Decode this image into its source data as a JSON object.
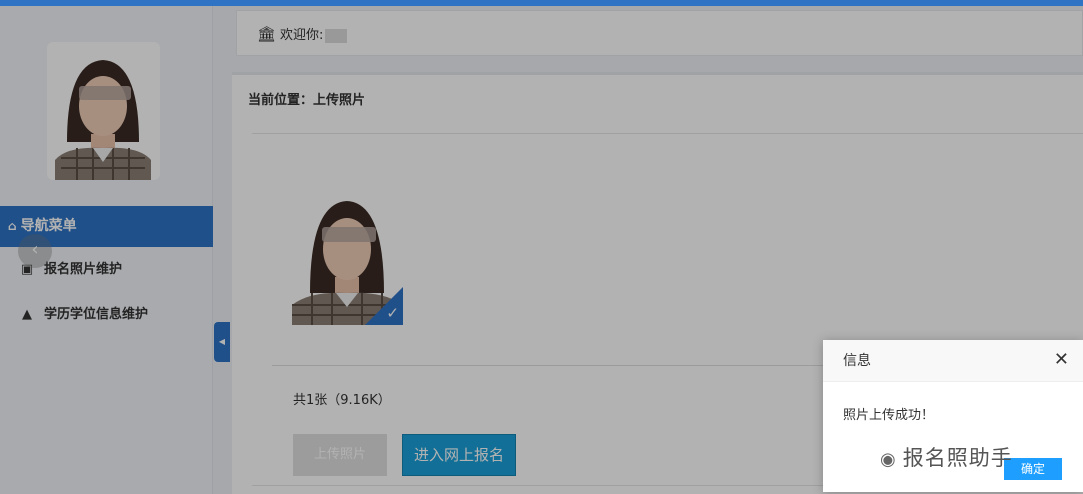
{
  "colors": {
    "accent": "#2f73c4",
    "primary_button": "#1aa0d8",
    "dialog_ok": "#1e9fff"
  },
  "header": {
    "welcome_label": "欢迎你:",
    "bank_icon": "bank-icon"
  },
  "sidebar": {
    "nav_title": "导航菜单",
    "items": [
      {
        "label": "报名照片维护",
        "icon": "image-icon"
      },
      {
        "label": "学历学位信息维护",
        "icon": "graduation-cap-icon"
      }
    ]
  },
  "main": {
    "breadcrumb": "当前位置：上传照片",
    "photo_count": "共1张（9.16K）",
    "upload_button": "上传照片",
    "enter_button": "进入网上报名"
  },
  "dialog": {
    "title": "信息",
    "message": "照片上传成功！",
    "ok_button": "确定",
    "watermark": "报名照助手"
  }
}
